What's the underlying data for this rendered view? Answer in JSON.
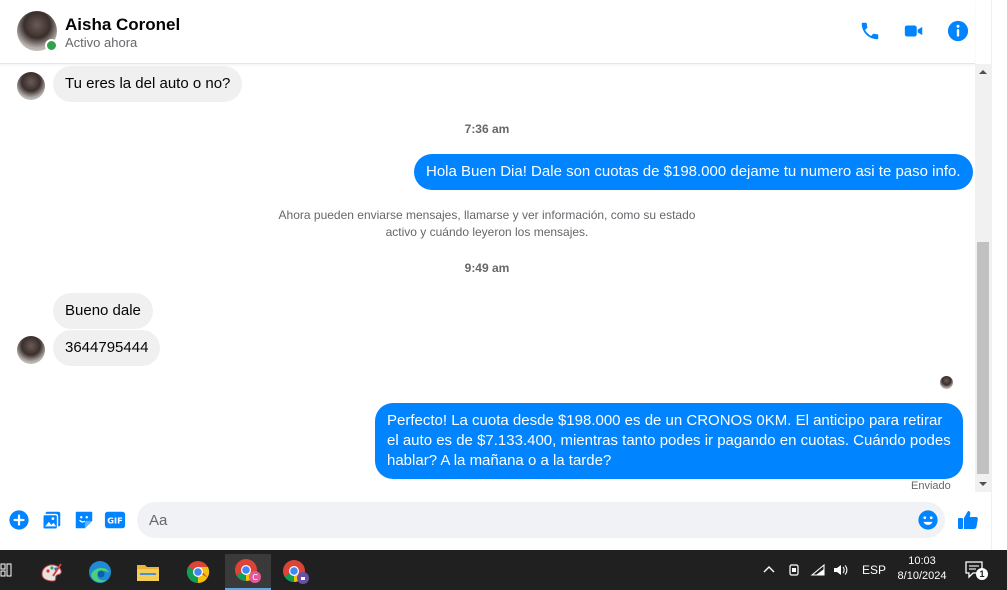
{
  "header": {
    "contact_name": "Aisha Coronel",
    "status": "Activo ahora"
  },
  "messages": {
    "m1": "Tu eres la del auto o no?",
    "time1": "7:36 am",
    "m2": "Hola Buen Dia! Dale son cuotas de $198.000 dejame tu numero asi te paso info.",
    "notice": "Ahora pueden enviarse mensajes, llamarse y ver información, como su estado activo y cuándo leyeron los mensajes.",
    "time2": "9:49 am",
    "m3": "Bueno dale",
    "m4": "3644795444",
    "m5": "Perfecto! La cuota desde $198.000 es de un CRONOS 0KM. El anticipo para retirar el auto es de $7.133.400, mientras tanto podes ir pagando en cuotas. Cuándo podes hablar? A la mañana o a la tarde?",
    "sent_status": "Enviado"
  },
  "composer": {
    "placeholder": "Aa"
  },
  "taskbar": {
    "language": "ESP",
    "time": "10:03",
    "date": "8/10/2024",
    "notification_count": "1"
  },
  "colors": {
    "accent": "#0084ff",
    "incoming_bubble": "#f0f0f0",
    "online": "#31a24c",
    "taskbar": "#202020"
  }
}
